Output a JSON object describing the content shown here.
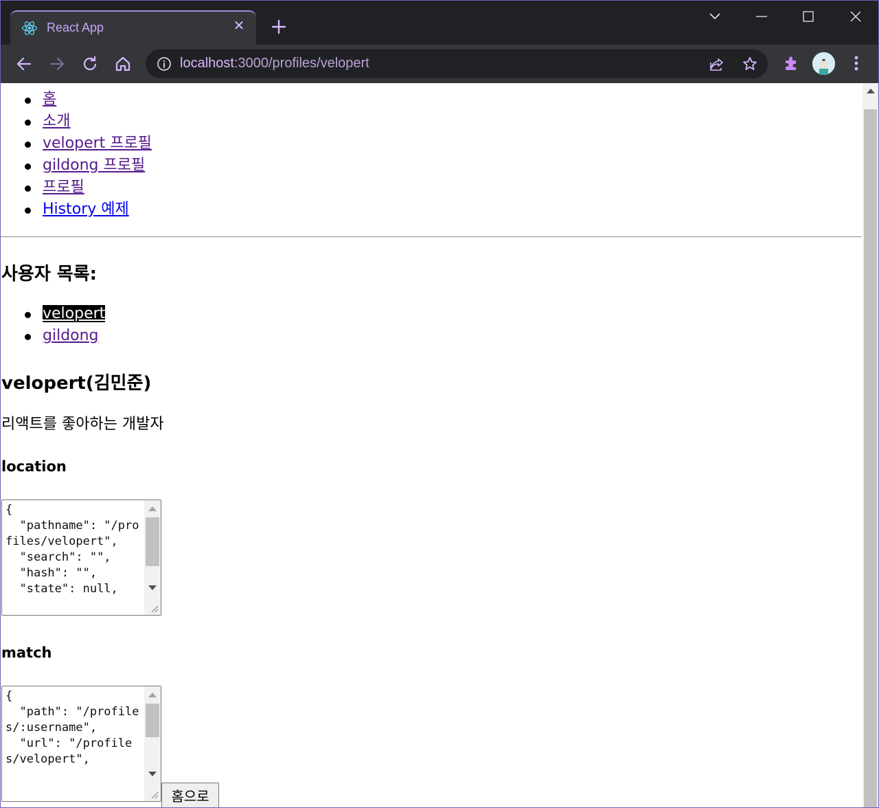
{
  "browser": {
    "tab_title": "React App",
    "url_host": "localhost",
    "url_rest": ":3000/profiles/velopert",
    "accent_color": "#c58af9"
  },
  "nav_links": [
    {
      "label": "홈",
      "state": "visited"
    },
    {
      "label": "소개",
      "state": "visited"
    },
    {
      "label": "velopert 프로필",
      "state": "visited"
    },
    {
      "label": "gildong 프로필",
      "state": "visited"
    },
    {
      "label": "프로필",
      "state": "visited"
    },
    {
      "label": "History 예제",
      "state": "unvisited"
    }
  ],
  "users_heading": "사용자 목록:",
  "user_links": [
    {
      "label": "velopert",
      "active": true
    },
    {
      "label": "gildong",
      "active": false
    }
  ],
  "profile": {
    "name": "velopert(김민준)",
    "description": "리액트를 좋아하는 개발자"
  },
  "location_heading": "location",
  "location_text": "{\n  \"pathname\": \"/profiles/velopert\",\n  \"search\": \"\",\n  \"hash\": \"\",\n  \"state\": null,",
  "match_heading": "match",
  "match_text": "{\n  \"path\": \"/profiles/:username\",\n  \"url\": \"/profiles/velopert\",",
  "home_button_label": "홈으로"
}
